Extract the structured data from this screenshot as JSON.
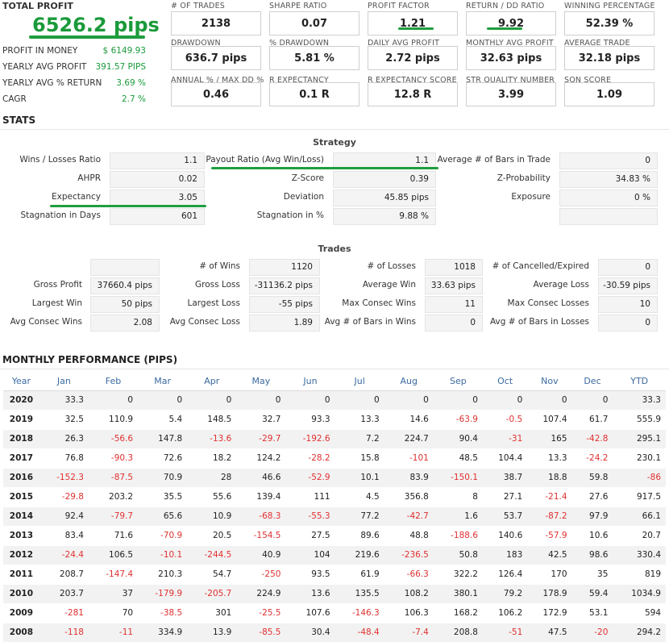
{
  "summary": {
    "title": "TOTAL PROFIT",
    "value": "6526.2 pips",
    "rows": [
      {
        "label": "PROFIT IN MONEY",
        "value": "$ 6149.93"
      },
      {
        "label": "YEARLY AVG PROFIT",
        "value": "391.57 PIPS"
      },
      {
        "label": "YEARLY AVG % RETURN",
        "value": "3.69 %"
      },
      {
        "label": "CAGR",
        "value": "2.7 %"
      }
    ]
  },
  "metrics": [
    {
      "label": "# OF TRADES",
      "value": "2138"
    },
    {
      "label": "SHARPE RATIO",
      "value": "0.07"
    },
    {
      "label": "PROFIT FACTOR",
      "value": "1.21"
    },
    {
      "label": "RETURN / DD RATIO",
      "value": "9.92"
    },
    {
      "label": "WINNING PERCENTAGE",
      "value": "52.39 %"
    },
    {
      "label": "DRAWDOWN",
      "value": "636.7 pips"
    },
    {
      "label": "% DRAWDOWN",
      "value": "5.81 %"
    },
    {
      "label": "DAILY AVG PROFIT",
      "value": "2.72 pips"
    },
    {
      "label": "MONTHLY AVG PROFIT",
      "value": "32.63 pips"
    },
    {
      "label": "AVERAGE TRADE",
      "value": "32.18 pips"
    },
    {
      "label": "ANNUAL % / MAX DD %",
      "value": "0.46"
    },
    {
      "label": "R EXPECTANCY",
      "value": "0.1 R"
    },
    {
      "label": "R EXPECTANCY SCORE",
      "value": "12.8 R"
    },
    {
      "label": "STR QUALITY NUMBER",
      "value": "3.99"
    },
    {
      "label": "SQN SCORE",
      "value": "1.09"
    }
  ],
  "stats": {
    "title": "STATS",
    "strategy_title": "Strategy",
    "strategy": [
      {
        "label": "Wins / Losses Ratio",
        "value": "1.1"
      },
      {
        "label": "Payout Ratio (Avg Win/Loss)",
        "value": "1.1"
      },
      {
        "label": "Average # of Bars in Trade",
        "value": "0"
      },
      {
        "label": "AHPR",
        "value": "0.02"
      },
      {
        "label": "Z-Score",
        "value": "0.39"
      },
      {
        "label": "Z-Probability",
        "value": "34.83 %"
      },
      {
        "label": "Expectancy",
        "value": "3.05"
      },
      {
        "label": "Deviation",
        "value": "45.85 pips"
      },
      {
        "label": "Exposure",
        "value": "0 %"
      },
      {
        "label": "Stagnation in Days",
        "value": "601"
      },
      {
        "label": "Stagnation in %",
        "value": "9.88 %"
      },
      {
        "label": "",
        "value": ""
      }
    ],
    "trades_title": "Trades",
    "trades": [
      {
        "label": "",
        "value": ""
      },
      {
        "label": "# of Wins",
        "value": "1120"
      },
      {
        "label": "# of Losses",
        "value": "1018"
      },
      {
        "label": "# of Cancelled/Expired",
        "value": "0"
      },
      {
        "label": "Gross Profit",
        "value": "37660.4 pips"
      },
      {
        "label": "Gross Loss",
        "value": "-31136.2 pips"
      },
      {
        "label": "Average Win",
        "value": "33.63 pips"
      },
      {
        "label": "Average Loss",
        "value": "-30.59 pips"
      },
      {
        "label": "Largest Win",
        "value": "50 pips"
      },
      {
        "label": "Largest Loss",
        "value": "-55 pips"
      },
      {
        "label": "Max Consec Wins",
        "value": "11"
      },
      {
        "label": "Max Consec Losses",
        "value": "10"
      },
      {
        "label": "Avg Consec Wins",
        "value": "2.08"
      },
      {
        "label": "Avg Consec Loss",
        "value": "1.89"
      },
      {
        "label": "Avg # of Bars in Wins",
        "value": "0"
      },
      {
        "label": "Avg # of Bars in Losses",
        "value": "0"
      }
    ]
  },
  "monthly": {
    "title": "MONTHLY PERFORMANCE (PIPS)",
    "headers": [
      "Year",
      "Jan",
      "Feb",
      "Mar",
      "Apr",
      "May",
      "Jun",
      "Jul",
      "Aug",
      "Sep",
      "Oct",
      "Nov",
      "Dec",
      "YTD"
    ],
    "rows": [
      [
        "2020",
        "33.3",
        "0",
        "0",
        "0",
        "0",
        "0",
        "0",
        "0",
        "0",
        "0",
        "0",
        "0",
        "33.3"
      ],
      [
        "2019",
        "32.5",
        "110.9",
        "5.4",
        "148.5",
        "32.7",
        "93.3",
        "13.3",
        "14.6",
        "-63.9",
        "-0.5",
        "107.4",
        "61.7",
        "555.9"
      ],
      [
        "2018",
        "26.3",
        "-56.6",
        "147.8",
        "-13.6",
        "-29.7",
        "-192.6",
        "7.2",
        "224.7",
        "90.4",
        "-31",
        "165",
        "-42.8",
        "295.1"
      ],
      [
        "2017",
        "76.8",
        "-90.3",
        "72.6",
        "18.2",
        "124.2",
        "-28.2",
        "15.8",
        "-101",
        "48.5",
        "104.4",
        "13.3",
        "-24.2",
        "230.1"
      ],
      [
        "2016",
        "-152.3",
        "-87.5",
        "70.9",
        "28",
        "46.6",
        "-52.9",
        "10.1",
        "83.9",
        "-150.1",
        "38.7",
        "18.8",
        "59.8",
        "-86"
      ],
      [
        "2015",
        "-29.8",
        "203.2",
        "35.5",
        "55.6",
        "139.4",
        "111",
        "4.5",
        "356.8",
        "8",
        "27.1",
        "-21.4",
        "27.6",
        "917.5"
      ],
      [
        "2014",
        "92.4",
        "-79.7",
        "65.6",
        "10.9",
        "-68.3",
        "-55.3",
        "77.2",
        "-42.7",
        "1.6",
        "53.7",
        "-87.2",
        "97.9",
        "66.1"
      ],
      [
        "2013",
        "83.4",
        "71.6",
        "-70.9",
        "20.5",
        "-154.5",
        "27.5",
        "89.6",
        "48.8",
        "-188.6",
        "140.6",
        "-57.9",
        "10.6",
        "20.7"
      ],
      [
        "2012",
        "-24.4",
        "106.5",
        "-10.1",
        "-244.5",
        "40.9",
        "104",
        "219.6",
        "-236.5",
        "50.8",
        "183",
        "42.5",
        "98.6",
        "330.4"
      ],
      [
        "2011",
        "208.7",
        "-147.4",
        "210.3",
        "54.7",
        "-250",
        "93.5",
        "61.9",
        "-66.3",
        "322.2",
        "126.4",
        "170",
        "35",
        "819"
      ],
      [
        "2010",
        "203.7",
        "37",
        "-179.9",
        "-205.7",
        "224.9",
        "13.6",
        "135.5",
        "108.2",
        "380.1",
        "79.2",
        "178.9",
        "59.4",
        "1034.9"
      ],
      [
        "2009",
        "-281",
        "70",
        "-38.5",
        "301",
        "-25.5",
        "107.6",
        "-146.3",
        "106.3",
        "168.2",
        "106.2",
        "172.9",
        "53.1",
        "594"
      ],
      [
        "2008",
        "-118",
        "-11",
        "334.9",
        "13.9",
        "-85.5",
        "30.4",
        "-48.4",
        "-7.4",
        "208.8",
        "-51",
        "47.5",
        "-20",
        "294.2"
      ]
    ]
  },
  "colors": {
    "accent_green": "#1e9e3e",
    "negative_red": "#e03030",
    "header_blue": "#3a6aa0"
  }
}
